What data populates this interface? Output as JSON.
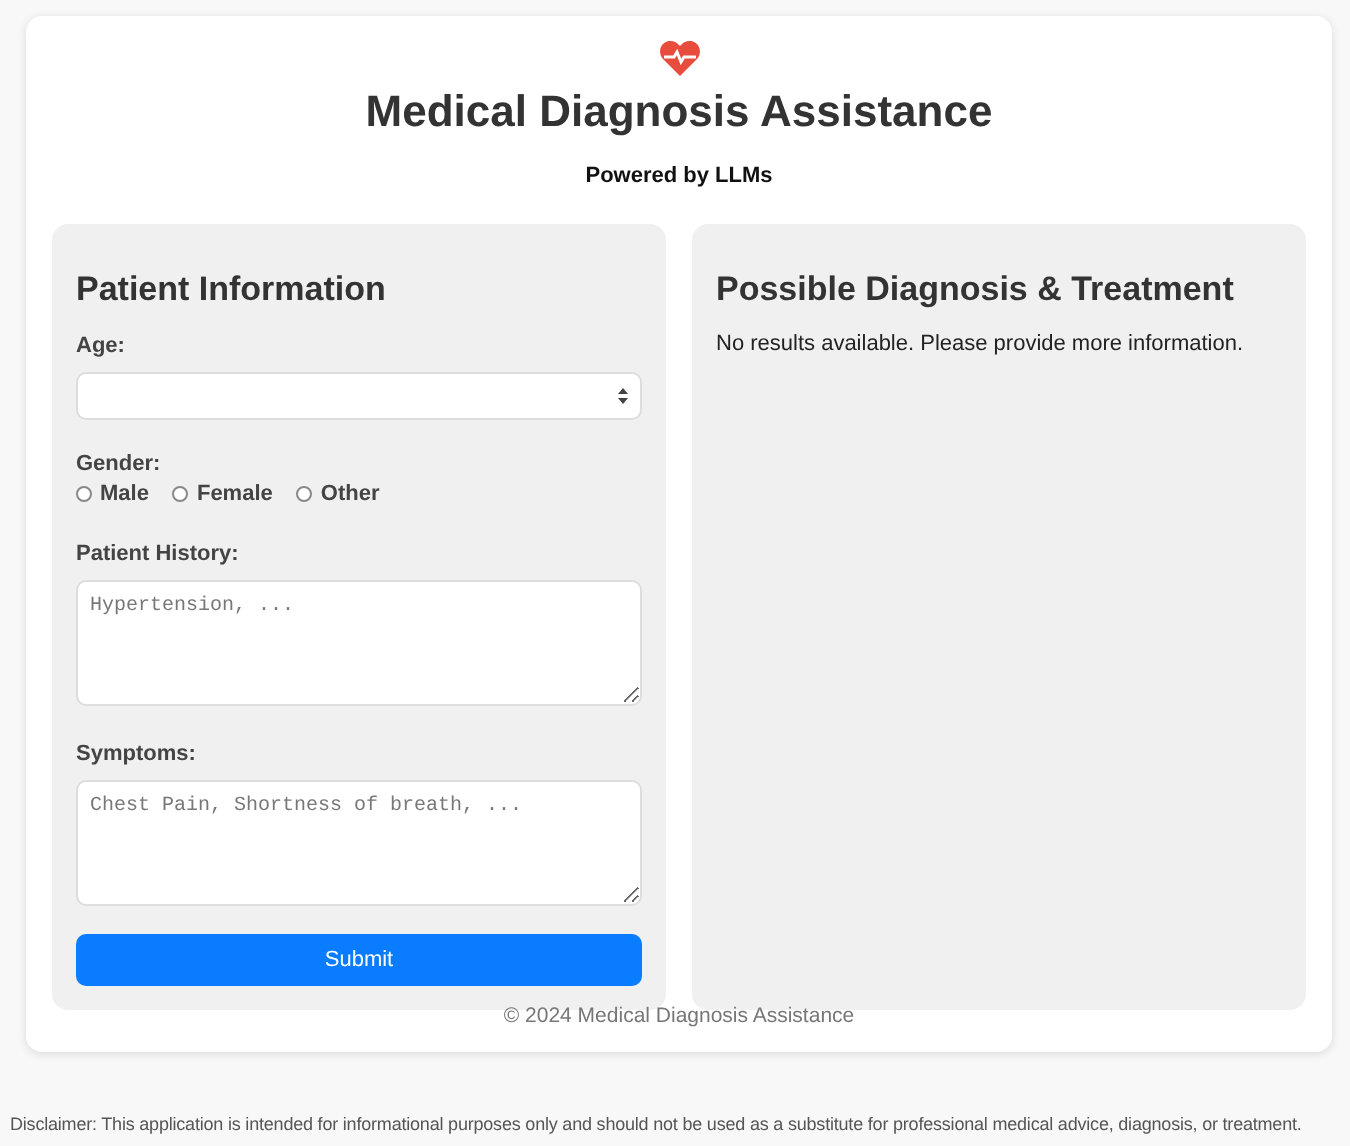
{
  "header": {
    "title": "Medical Diagnosis Assistance",
    "subtitle": "Powered by LLMs"
  },
  "patient_form": {
    "heading": "Patient Information",
    "age": {
      "label": "Age:"
    },
    "gender": {
      "label": "Gender:",
      "options": [
        {
          "label": "Male",
          "selected": false
        },
        {
          "label": "Female",
          "selected": false
        },
        {
          "label": "Other",
          "selected": false
        }
      ]
    },
    "history": {
      "label": "Patient History:",
      "placeholder": "Hypertension, ..."
    },
    "symptoms": {
      "label": "Symptoms:",
      "placeholder": "Chest Pain, Shortness of breath, ..."
    },
    "submit": "Submit"
  },
  "results": {
    "heading": "Possible Diagnosis & Treatment",
    "message": "No results available. Please provide more information."
  },
  "footer": "© 2024 Medical Diagnosis Assistance",
  "disclaimer": "Disclaimer: This application is intended for informational purposes only and should not be used as a substitute for professional medical advice, diagnosis, or treatment."
}
